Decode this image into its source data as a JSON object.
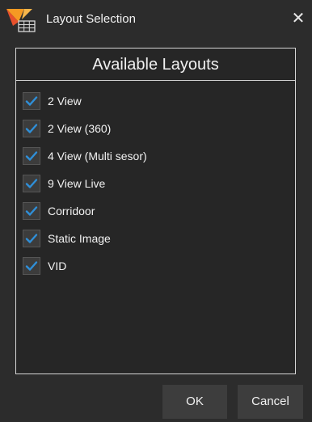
{
  "window": {
    "title": "Layout Selection",
    "close_symbol": "✕",
    "app_icon": "app-logo-icon"
  },
  "panel": {
    "header": "Available Layouts",
    "items": [
      {
        "label": "2 View",
        "checked": true
      },
      {
        "label": "2 View (360)",
        "checked": true
      },
      {
        "label": "4 View (Multi sesor)",
        "checked": true
      },
      {
        "label": "9 View Live",
        "checked": true
      },
      {
        "label": "Corridoor",
        "checked": true
      },
      {
        "label": "Static Image",
        "checked": true
      },
      {
        "label": "VID",
        "checked": true
      }
    ]
  },
  "buttons": {
    "ok": "OK",
    "cancel": "Cancel"
  },
  "colors": {
    "background": "#2c2c2c",
    "check": "#2f8fd8",
    "border": "#d6d6d6",
    "icon_orange": "#f59a23",
    "icon_red": "#e8512c"
  }
}
